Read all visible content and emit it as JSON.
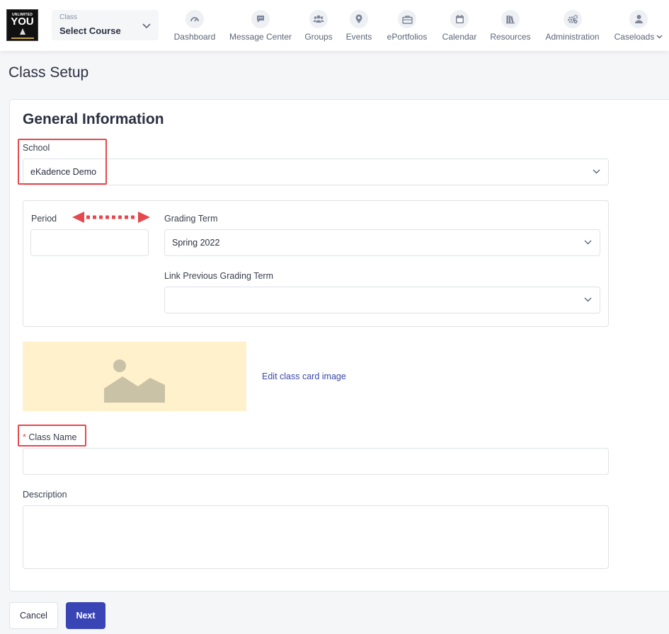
{
  "logo": {
    "line1": "UNLIMITED",
    "line2": "YOU"
  },
  "class_selector": {
    "caption": "Class",
    "value": "Select Course"
  },
  "nav": [
    {
      "label": "Dashboard",
      "icon": "gauge-icon"
    },
    {
      "label": "Message Center",
      "icon": "chat-bubble-icon"
    },
    {
      "label": "Groups",
      "icon": "users-icon"
    },
    {
      "label": "Events",
      "icon": "map-pin-icon"
    },
    {
      "label": "ePortfolios",
      "icon": "briefcase-icon"
    },
    {
      "label": "Calendar",
      "icon": "calendar-icon"
    },
    {
      "label": "Resources",
      "icon": "books-icon"
    },
    {
      "label": "Administration",
      "icon": "gears-icon"
    },
    {
      "label": "Caseloads",
      "icon": "user-icon"
    }
  ],
  "page": {
    "title": "Class Setup"
  },
  "form": {
    "section_title": "General Information",
    "school": {
      "label": "School",
      "value": "eKadence Demo"
    },
    "period": {
      "label": "Period",
      "value": ""
    },
    "grading_term": {
      "label": "Grading Term",
      "value": "Spring 2022"
    },
    "link_previous": {
      "label": "Link Previous Grading Term",
      "value": ""
    },
    "edit_image_label": "Edit class card image",
    "class_name": {
      "required_mark": "*",
      "label": "Class Name",
      "value": ""
    },
    "description": {
      "label": "Description",
      "value": ""
    }
  },
  "actions": {
    "cancel": "Cancel",
    "next": "Next"
  },
  "colors": {
    "accent": "#3a45b5",
    "annotation_red": "#e5484d",
    "image_placeholder_bg": "#fff1cc",
    "image_placeholder_shape": "#c9c2a6"
  }
}
